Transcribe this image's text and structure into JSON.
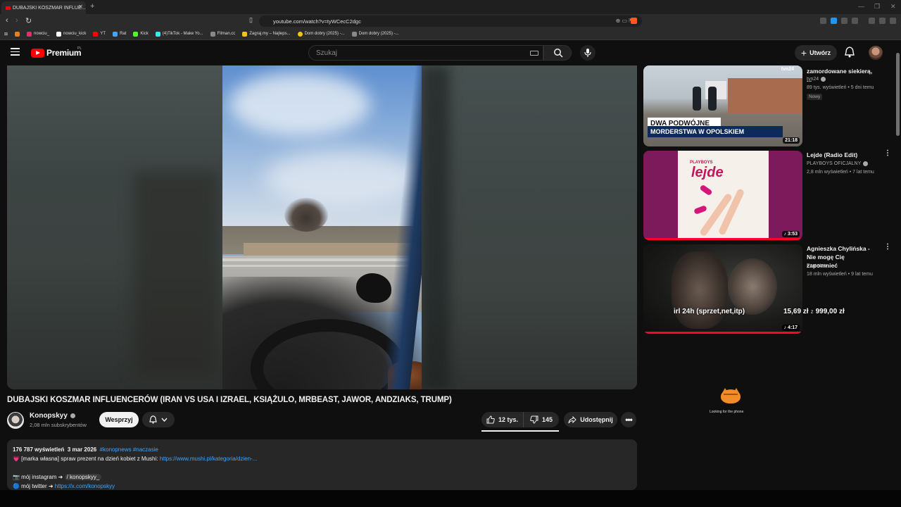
{
  "browser": {
    "tab_title": "DUBAJSKI KOSZMAR INFLUE...",
    "url": "youtube.com/watch?v=tyWCecC2dgc",
    "new_tab": "+",
    "bookmarks": [
      {
        "label": "nowciu_",
        "color": "#e1306c"
      },
      {
        "label": "nowciu_kick",
        "color": "#ffffff"
      },
      {
        "label": "YT",
        "color": "#ff0000"
      },
      {
        "label": "Rat",
        "color": "#3ea6ff"
      },
      {
        "label": "Kick",
        "color": "#53fc18"
      },
      {
        "label": "(4)TikTok - Make Yo...",
        "color": "#25f4ee"
      },
      {
        "label": "Filman.cc",
        "color": "#888888"
      },
      {
        "label": "Zagraj.my – Najleps...",
        "color": "#f1c40f"
      },
      {
        "label": "Dom dobry (2025) -...",
        "color": "#f1c40f"
      },
      {
        "label": "Dom dobry (2025) -...",
        "color": "#888888"
      }
    ]
  },
  "header": {
    "logo_text": "Premium",
    "logo_region": "PL",
    "search_placeholder": "Szukaj",
    "create_label": "Utwórz",
    "create_plus": "+"
  },
  "video": {
    "title": "DUBAJSKI KOSZMAR INFLUENCERÓW (IRAN VS USA I IZRAEL, KSIĄŻULO, MRBEAST, JAWOR, ANDZIAKS, TRUMP)",
    "channel": "Konopskyy",
    "subscribers": "2,08 mln subskrybentów",
    "support_label": "Wesprzyj",
    "likes": "12 tys.",
    "dislikes": "145",
    "share_label": "Udostępnij",
    "more": "•••"
  },
  "description": {
    "views": "176 787 wyświetleń",
    "date": "3 mar 2026",
    "hashtags": "#konopnews #naczasie",
    "line2_prefix": "💗 [marka własna] spraw prezent na dzień kobiet z Mushi: ",
    "line2_link": "https://www.mushi.pl/kategoria/dzien-...",
    "line3_prefix": "📷 mój instagram ➜ ",
    "line3_handle": "/ konopskyy_",
    "line4_prefix": "🔵 mój twitter ➜ ",
    "line4_link": "https://x.com/konopskyy"
  },
  "recommendations": [
    {
      "title": "zamordowane siekierą, ...",
      "channel": "tvn24",
      "meta": "89 tys. wyświetleń • 5 dni temu",
      "badge": "Nowy",
      "duration": "21:18",
      "banner1": "DWA PODWÓJNE",
      "banner2": "MORDERSTWA W OPOLSKIEM",
      "thumb_logo": "tvn24"
    },
    {
      "title": "Lejde (Radio Edit)",
      "channel": "PLAYBOYS OFICJALNY",
      "meta": "2,8 mln wyświetleń • 7 lat temu",
      "duration": "3:53",
      "cover_brand": "PLAYBOYS",
      "cover_title": "lejde"
    },
    {
      "title": "Agnieszka Chylińska - Nie mogę Cię zapomnieć",
      "channel": "Pomaton",
      "meta": "18 mln wyświetleń • 9 lat temu",
      "duration": "4:17"
    }
  ],
  "overlay": {
    "goal_text": "irl 24h (sprzet,net,itp)",
    "raised": "15,69 zł",
    "separator": "z",
    "goal": "999,00 zł",
    "looking": "Looking for the phone"
  },
  "colors": {
    "yt_red": "#ff0000",
    "link_blue": "#3ea6ff",
    "background": "#0f0f0f"
  }
}
